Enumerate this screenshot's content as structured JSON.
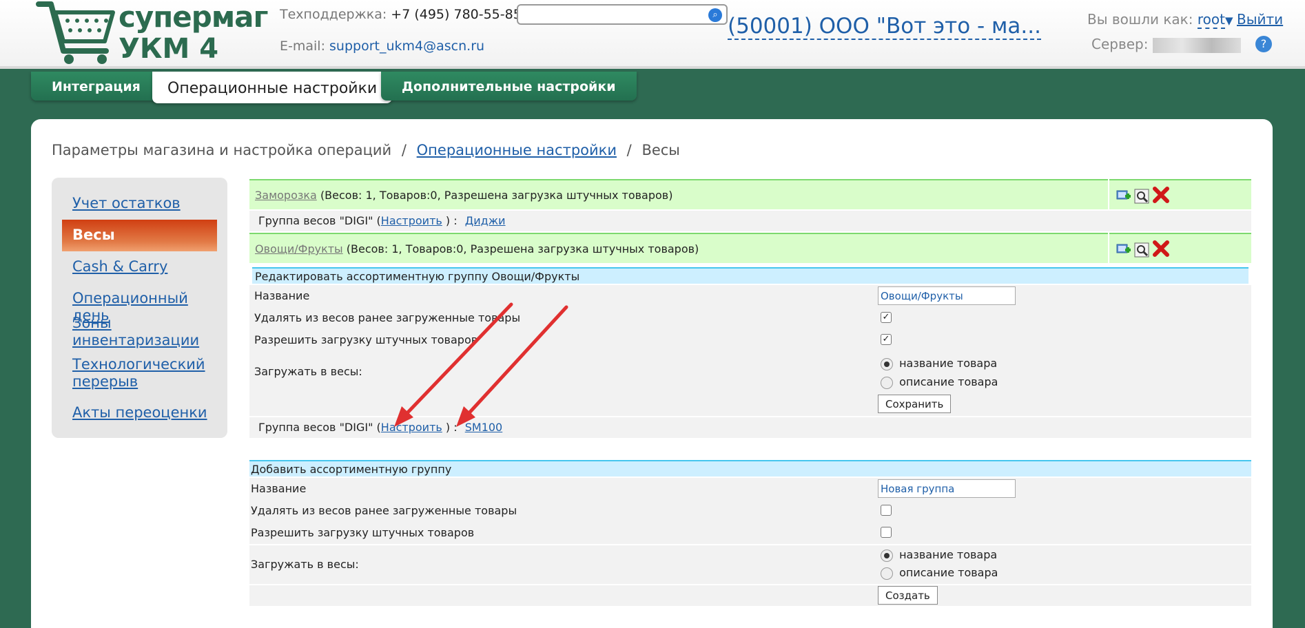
{
  "header": {
    "logo_line1": "супермаг",
    "logo_line2": "УКМ 4",
    "support_label": "Техподдержка:",
    "support_phone": "+7 (495) 780-55-85",
    "email_label": "E-mail:",
    "email": "support_ukm4@ascn.ru",
    "search_placeholder": "",
    "store": "(50001) ООО \"Вот это - ма...",
    "login_label": "Вы вошли как:",
    "user": "root",
    "logout": "Выйти",
    "server_label": "Сервер:"
  },
  "tabs": [
    "Интеграция",
    "Операционные настройки",
    "Дополнительные настройки"
  ],
  "breadcrumb": {
    "root": "Параметры магазина и настройка операций",
    "sep": "/",
    "link": "Операционные настройки",
    "current": "Весы"
  },
  "sidebar": {
    "items": [
      "Учет остатков",
      "Весы",
      "Cash & Carry",
      "Операционный день",
      "Зоны инвентаризации",
      "Технологический перерыв",
      "Акты переоценки"
    ]
  },
  "groups": [
    {
      "name": "Заморозка",
      "info": "(Весов: 1, Товаров:0, Разрешена загрузка штучных товаров)",
      "sub_prefix": "Группа весов \"DIGI\" (",
      "sub_config": "Настроить",
      "sub_suffix": ") :",
      "sub_scale": "Диджи"
    },
    {
      "name": "Овощи/Фрукты",
      "info": "(Весов: 1, Товаров:0, Разрешена загрузка штучных товаров)",
      "sub_prefix": "Группа весов \"DIGI\" (",
      "sub_config": "Настроить",
      "sub_suffix": ") :",
      "sub_scale": "SM100"
    }
  ],
  "edit_form": {
    "title": "Редактировать ассортиментную группу Овощи/Фрукты",
    "name_label": "Название",
    "name_value": "Овощи/Фрукты",
    "delete_label": "Удалять из весов ранее загруженные товары",
    "delete_checked": true,
    "piece_label": "Разрешить загрузку штучных товаров",
    "piece_checked": true,
    "load_label": "Загружать в весы:",
    "opt_name": "название товара",
    "opt_desc": "описание товара",
    "selected": "название товара",
    "save": "Сохранить"
  },
  "add_form": {
    "title": "Добавить ассортиментную группу",
    "name_label": "Название",
    "name_value": "Новая группа",
    "delete_label": "Удалять из весов ранее загруженные товары",
    "delete_checked": false,
    "piece_label": "Разрешить загрузку штучных товаров",
    "piece_checked": false,
    "load_label": "Загружать в весы:",
    "opt_name": "название товара",
    "opt_desc": "описание товара",
    "selected": "название товара",
    "create": "Создать"
  },
  "icons": [
    "add-scale-icon",
    "view-icon",
    "delete-icon",
    "search-icon",
    "help-icon",
    "cart-logo-icon",
    "arrow-annotation-icon"
  ],
  "colors": {
    "brand_green": "#2c6b4f",
    "link_blue": "#1f5fa8",
    "active_orange": "#d03f12",
    "group_row": "#d9fdca",
    "form_head": "#cdefff"
  }
}
